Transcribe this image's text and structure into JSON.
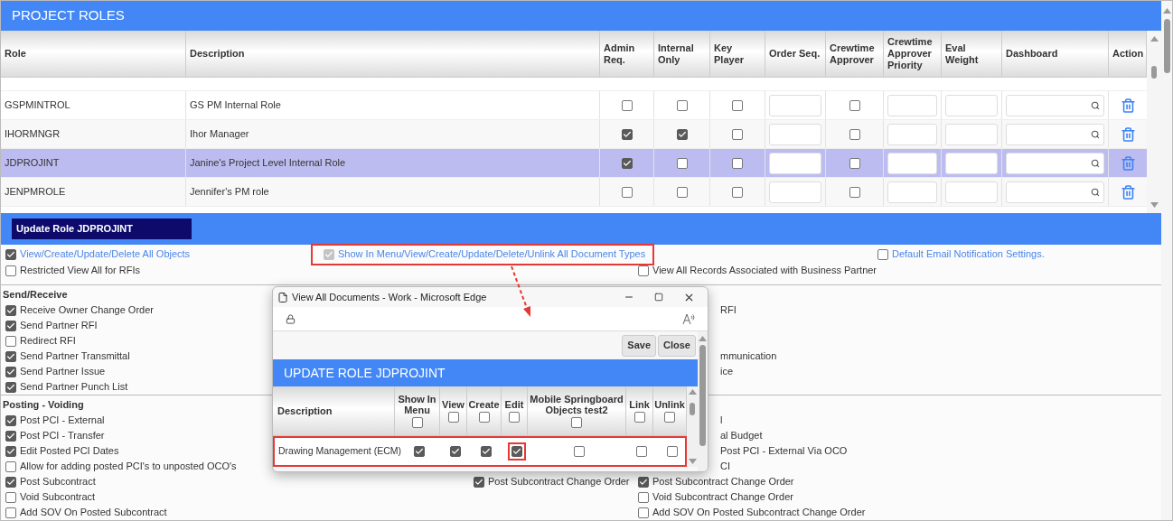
{
  "title": "PROJECT ROLES",
  "table": {
    "columns": [
      "Role",
      "Description",
      "Admin Req.",
      "Internal Only",
      "Key Player",
      "Order Seq.",
      "Crewtime Approver",
      "Crewtime Approver Priority",
      "Eval Weight",
      "Dashboard",
      "Action"
    ],
    "rows": [
      {
        "role": "GSPMINTROL",
        "description": "GS PM Internal Role",
        "admin_req": false,
        "internal_only": false,
        "key_player": false,
        "crewtime_approver": false,
        "selected": false
      },
      {
        "role": "IHORMNGR",
        "description": "Ihor Manager",
        "admin_req": true,
        "internal_only": true,
        "key_player": false,
        "crewtime_approver": false,
        "selected": false
      },
      {
        "role": "JDPROJINT",
        "description": "Janine's Project Level Internal Role",
        "admin_req": true,
        "internal_only": false,
        "key_player": false,
        "crewtime_approver": false,
        "selected": true
      },
      {
        "role": "JENPMROLE",
        "description": "Jennifer's PM role",
        "admin_req": false,
        "internal_only": false,
        "key_player": false,
        "crewtime_approver": false,
        "selected": false
      }
    ]
  },
  "update_bar": {
    "label": "Update Role JDPROJINT"
  },
  "sections": [
    {
      "rows": [
        [
          {
            "kind": "link",
            "checked": true,
            "text": "View/Create/Update/Delete All Objects"
          },
          {
            "kind": "link",
            "checked": true,
            "disabled": true,
            "highlighted": true,
            "text": "Show In Menu/View/Create/Update/Delete/Unlink All Document Types"
          },
          null,
          null,
          {
            "kind": "link",
            "checked": false,
            "text": "Default Email Notification Settings."
          }
        ],
        [
          {
            "kind": "checkbox",
            "checked": false,
            "text": "Restricted View All for RFIs"
          },
          null,
          null,
          {
            "kind": "checkbox",
            "checked": false,
            "text": "View All Records Associated with Business Partner"
          },
          null
        ]
      ]
    },
    {
      "heading": "Send/Receive",
      "rows": [
        [
          {
            "kind": "checkbox",
            "checked": true,
            "text": "Receive Owner Change Order"
          },
          null,
          null,
          {
            "kind": "fragment",
            "text": "RFI"
          },
          null
        ],
        [
          {
            "kind": "checkbox",
            "checked": true,
            "text": "Send Partner RFI"
          },
          null,
          null,
          null,
          null
        ],
        [
          {
            "kind": "checkbox",
            "checked": false,
            "text": "Redirect RFI"
          },
          null,
          null,
          null,
          null
        ],
        [
          {
            "kind": "checkbox",
            "checked": true,
            "text": "Send Partner Transmittal"
          },
          null,
          null,
          {
            "kind": "fragment",
            "text": "mmunication"
          },
          null
        ],
        [
          {
            "kind": "checkbox",
            "checked": true,
            "text": "Send Partner Issue"
          },
          null,
          null,
          {
            "kind": "fragment",
            "text": "ice"
          },
          null
        ],
        [
          {
            "kind": "checkbox",
            "checked": true,
            "text": "Send Partner Punch List"
          },
          null,
          null,
          null,
          null
        ]
      ]
    },
    {
      "heading": "Posting - Voiding",
      "rows": [
        [
          {
            "kind": "checkbox",
            "checked": true,
            "text": "Post PCI - External"
          },
          null,
          null,
          {
            "kind": "fragment",
            "text": "l"
          },
          null
        ],
        [
          {
            "kind": "checkbox",
            "checked": true,
            "text": "Post PCI - Transfer"
          },
          null,
          null,
          {
            "kind": "fragment",
            "text": "al Budget"
          },
          null
        ],
        [
          {
            "kind": "checkbox",
            "checked": true,
            "text": "Edit Posted PCI Dates"
          },
          null,
          null,
          {
            "kind": "fragment",
            "text": "Post PCI - External Via OCO"
          },
          null
        ],
        [
          {
            "kind": "checkbox",
            "checked": false,
            "text": "Allow for adding posted PCI's to unposted OCO's"
          },
          null,
          null,
          {
            "kind": "fragment",
            "text": "CI"
          },
          null
        ],
        [
          {
            "kind": "checkbox",
            "checked": true,
            "text": "Post Subcontract"
          },
          null,
          {
            "kind": "checkbox",
            "checked": true,
            "text": "Post Subcontract Change Order"
          },
          {
            "kind": "checkbox",
            "checked": true,
            "text": "Post Subcontract Change Order"
          },
          null
        ],
        [
          {
            "kind": "checkbox",
            "checked": false,
            "text": "Void Subcontract"
          },
          null,
          null,
          {
            "kind": "checkbox",
            "checked": false,
            "text": "Void Subcontract Change Order"
          },
          null
        ],
        [
          {
            "kind": "checkbox",
            "checked": false,
            "text": "Add SOV On Posted Subcontract"
          },
          null,
          null,
          {
            "kind": "checkbox",
            "checked": false,
            "text": "Add SOV On Posted Subcontract Change Order"
          },
          null
        ]
      ]
    }
  ],
  "popup": {
    "window_title": "View All Documents - Work - Microsoft Edge",
    "buttons": [
      "Save",
      "Close"
    ],
    "heading": "UPDATE ROLE JDPROJINT",
    "columns": [
      {
        "kind": "text",
        "label": "Description"
      },
      {
        "kind": "check_all",
        "label": "Show In Menu",
        "checked": false
      },
      {
        "kind": "check_all",
        "label": "View",
        "checked": false
      },
      {
        "kind": "check_all",
        "label": "Create",
        "checked": false
      },
      {
        "kind": "check_all",
        "label": "Edit",
        "checked": false
      },
      {
        "kind": "check_all",
        "label": "Mobile Springboard Objects test2",
        "checked": false
      },
      {
        "kind": "check_all",
        "label": "Link",
        "checked": false
      },
      {
        "kind": "check_all",
        "label": "Unlink",
        "checked": false
      }
    ],
    "row": {
      "description": "Drawing Management (ECM)",
      "highlighted": true,
      "cells": [
        {
          "checked": true,
          "highlighted": false
        },
        {
          "checked": true,
          "highlighted": false
        },
        {
          "checked": true,
          "highlighted": false
        },
        {
          "checked": true,
          "highlighted": true
        },
        {
          "checked": false,
          "highlighted": false
        },
        {
          "checked": false,
          "highlighted": false
        },
        {
          "checked": false,
          "highlighted": false
        }
      ]
    }
  }
}
